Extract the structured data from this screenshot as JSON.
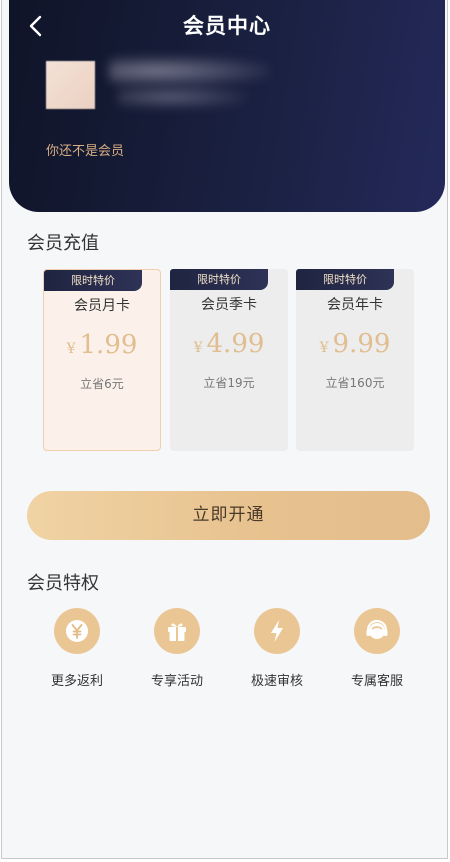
{
  "header": {
    "title": "会员中心",
    "status_text": "你还不是会员"
  },
  "recharge": {
    "title": "会员充值",
    "cards": [
      {
        "tag": "限时特价",
        "name": "会员月卡",
        "currency": "¥",
        "price": "1.99",
        "save": "立省6元",
        "selected": true
      },
      {
        "tag": "限时特价",
        "name": "会员季卡",
        "currency": "¥",
        "price": "4.99",
        "save": "立省19元",
        "selected": false
      },
      {
        "tag": "限时特价",
        "name": "会员年卡",
        "currency": "¥",
        "price": "9.99",
        "save": "立省160元",
        "selected": false
      }
    ]
  },
  "action": {
    "open_label": "立即开通"
  },
  "privileges": {
    "title": "会员特权",
    "items": [
      {
        "label": "更多返利",
        "icon": "yen-coin-icon"
      },
      {
        "label": "专享活动",
        "icon": "gift-icon"
      },
      {
        "label": "极速审核",
        "icon": "lightning-icon"
      },
      {
        "label": "专属客服",
        "icon": "headset-icon"
      }
    ]
  },
  "colors": {
    "header_bg": "#1a2040",
    "accent_gold": "#e7c18e",
    "status_text": "#d7ae84",
    "price": "#e0be8f"
  }
}
